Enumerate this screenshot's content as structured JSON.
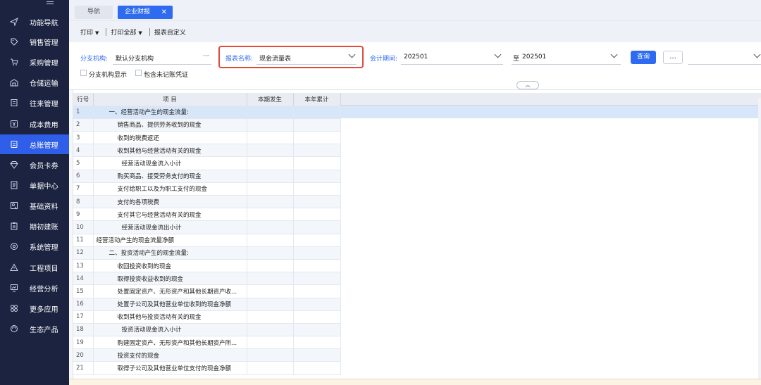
{
  "sidebar": {
    "items": [
      {
        "label": "功能导航",
        "icon": "send-icon"
      },
      {
        "label": "销售管理",
        "icon": "tag-icon"
      },
      {
        "label": "采购管理",
        "icon": "cart-icon"
      },
      {
        "label": "仓储运输",
        "icon": "warehouse-icon"
      },
      {
        "label": "往来管理",
        "icon": "ledger-icon"
      },
      {
        "label": "成本费用",
        "icon": "yen-icon"
      },
      {
        "label": "总账管理",
        "icon": "book-icon"
      },
      {
        "label": "会员卡券",
        "icon": "diamond-icon"
      },
      {
        "label": "单据中心",
        "icon": "document-icon"
      },
      {
        "label": "基础资料",
        "icon": "profile-icon"
      },
      {
        "label": "期初建账",
        "icon": "clipboard-icon"
      },
      {
        "label": "系统管理",
        "icon": "settings-icon"
      },
      {
        "label": "工程项目",
        "icon": "warning-triangle-icon"
      },
      {
        "label": "经营分析",
        "icon": "chart-icon"
      },
      {
        "label": "更多应用",
        "icon": "grid-icon"
      },
      {
        "label": "生态产品",
        "icon": "ecosystem-icon"
      }
    ],
    "active_index": 6,
    "active_color": "#2f5ee8"
  },
  "tabs": [
    {
      "label": "导航"
    },
    {
      "label": "企业财报",
      "close": "✕"
    }
  ],
  "toolbar": {
    "print": "打印",
    "print_all": "打印全部",
    "report_custom": "报表自定义"
  },
  "filters": {
    "branch_label": "分支机构:",
    "branch_value": "默认分支机构",
    "branch_more": "···",
    "report_label": "报表名称:",
    "report_value": "现金流量表",
    "period_label": "会计期间:",
    "period_from": "202501",
    "period_to_label": "至",
    "period_to": "202501",
    "query_btn": "查询",
    "more_btn": "...",
    "show_branch": "分支机构显示",
    "include_unposted": "包含未记账凭证"
  },
  "table": {
    "headers": [
      "行号",
      "项 目",
      "本期发生",
      "本年累计"
    ],
    "rows": [
      {
        "no": "1",
        "item": "一、经营活动产生的现金流量:",
        "indent": 1
      },
      {
        "no": "2",
        "item": "销售商品、提供劳务收到的现金",
        "indent": 2
      },
      {
        "no": "3",
        "item": "收到的税费返还",
        "indent": 2
      },
      {
        "no": "4",
        "item": "收到其他与经营活动有关的现金",
        "indent": 2
      },
      {
        "no": "5",
        "item": "经营活动现金流入小计",
        "indent": 3
      },
      {
        "no": "6",
        "item": "购买商品、接受劳务支付的现金",
        "indent": 2
      },
      {
        "no": "7",
        "item": "支付给职工以及为职工支付的现金",
        "indent": 2
      },
      {
        "no": "8",
        "item": "支付的各项税费",
        "indent": 2
      },
      {
        "no": "9",
        "item": "支付其它与经营活动有关的现金",
        "indent": 2
      },
      {
        "no": "10",
        "item": "经营活动现金流出小计",
        "indent": 3
      },
      {
        "no": "11",
        "item": "经营活动产生的现金流量净额",
        "indent": 0
      },
      {
        "no": "12",
        "item": "二、投资活动产生的现金流量:",
        "indent": 1
      },
      {
        "no": "13",
        "item": "收回投资收到的现金",
        "indent": 2
      },
      {
        "no": "14",
        "item": "取得投资收益收到的现金",
        "indent": 2
      },
      {
        "no": "15",
        "item": "处置固定资产、无形资产和其他长期资产收...",
        "indent": 2
      },
      {
        "no": "16",
        "item": "处置子公司及其他营业单位收到的现金净额",
        "indent": 2
      },
      {
        "no": "17",
        "item": "收到其他与投资活动有关的现金",
        "indent": 2
      },
      {
        "no": "18",
        "item": "投资活动现金流入小计",
        "indent": 3
      },
      {
        "no": "19",
        "item": "购建固定资产、无形资产和其他长期资产所...",
        "indent": 2
      },
      {
        "no": "20",
        "item": "投资支付的现金",
        "indent": 2
      },
      {
        "no": "21",
        "item": "取得子公司及其他营业单位支付的现金净额",
        "indent": 2
      }
    ]
  }
}
